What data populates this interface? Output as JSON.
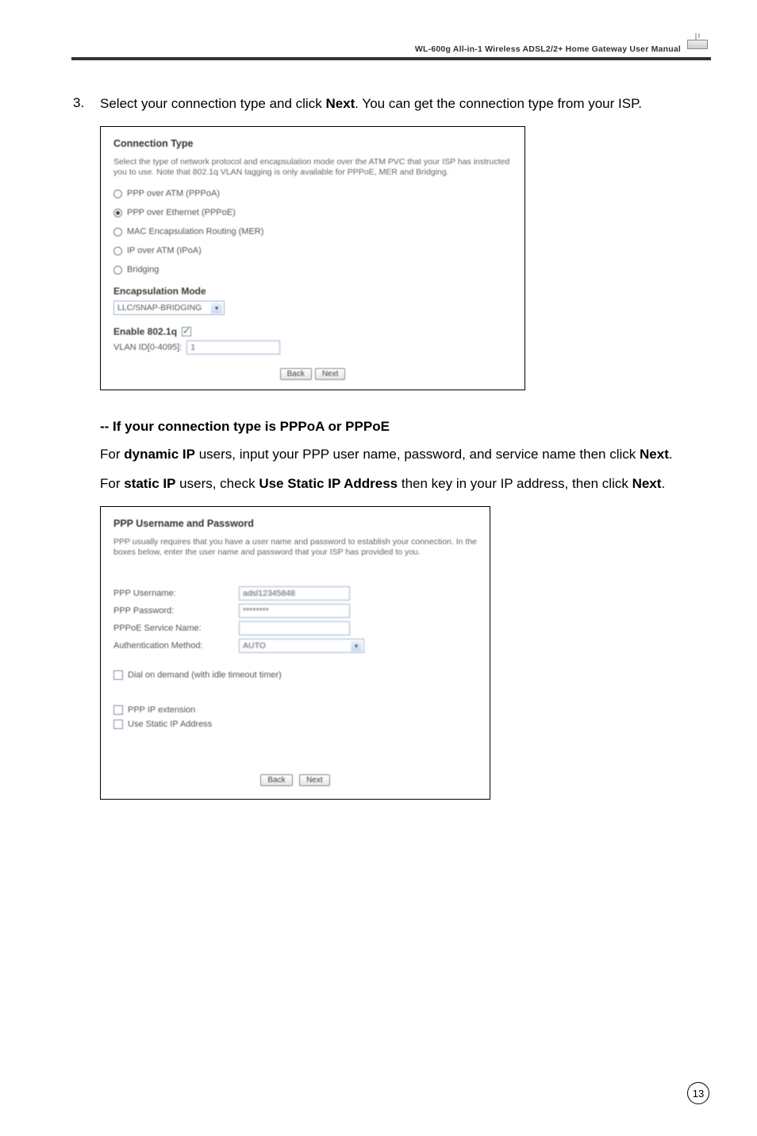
{
  "manual_header": "WL-600g All-in-1 Wireless ADSL2/2+ Home Gateway User Manual",
  "page_number": "13",
  "step": {
    "number": "3.",
    "text_before_bold": "Select your connection type and click ",
    "bold": "Next",
    "text_after_bold": ". You can get the connection type from your ISP."
  },
  "shot1": {
    "heading": "Connection Type",
    "intro": "Select the type of network protocol and encapsulation mode over the ATM PVC that your ISP has instructed you to use. Note that 802.1q VLAN tagging is only available for PPPoE, MER and Bridging.",
    "options": [
      {
        "label": "PPP over ATM (PPPoA)",
        "selected": false
      },
      {
        "label": "PPP over Ethernet (PPPoE)",
        "selected": true
      },
      {
        "label": "MAC Encapsulation Routing (MER)",
        "selected": false
      },
      {
        "label": "IP over ATM (IPoA)",
        "selected": false
      },
      {
        "label": "Bridging",
        "selected": false
      }
    ],
    "enc_label": "Encapsulation Mode",
    "enc_value": "LLC/SNAP-BRIDGING",
    "enable_label": "Enable 802.1q",
    "vlan_label": "VLAN ID[0-4095]:",
    "vlan_value": "1",
    "back": "Back",
    "next": "Next"
  },
  "sub_heading": "-- If your connection type is PPPoA or PPPoE",
  "para1": {
    "a": "For ",
    "b": "dynamic IP",
    "c": " users, input your PPP user name, password, and service name then click ",
    "d": "Next",
    "e": "."
  },
  "para2": {
    "a": "For ",
    "b": "static IP",
    "c": " users, check ",
    "d": "Use Static IP Address",
    "e": " then key in your IP address, then click ",
    "f": "Next",
    "g": "."
  },
  "shot2": {
    "heading": "PPP Username and Password",
    "intro": "PPP usually requires that you have a user name and password to establish your connection. In the boxes below, enter the user name and password that your ISP has provided to you.",
    "fields": {
      "username_label": "PPP Username:",
      "username_value": "adsl12345848",
      "password_label": "PPP Password:",
      "password_value": "********",
      "service_label": "PPPoE Service Name:",
      "service_value": "",
      "auth_label": "Authentication Method:",
      "auth_value": "AUTO"
    },
    "checks": {
      "dial": "Dial on demand (with idle timeout timer)",
      "pppip": "PPP IP extension",
      "static": "Use Static IP Address"
    },
    "back": "Back",
    "next": "Next"
  }
}
